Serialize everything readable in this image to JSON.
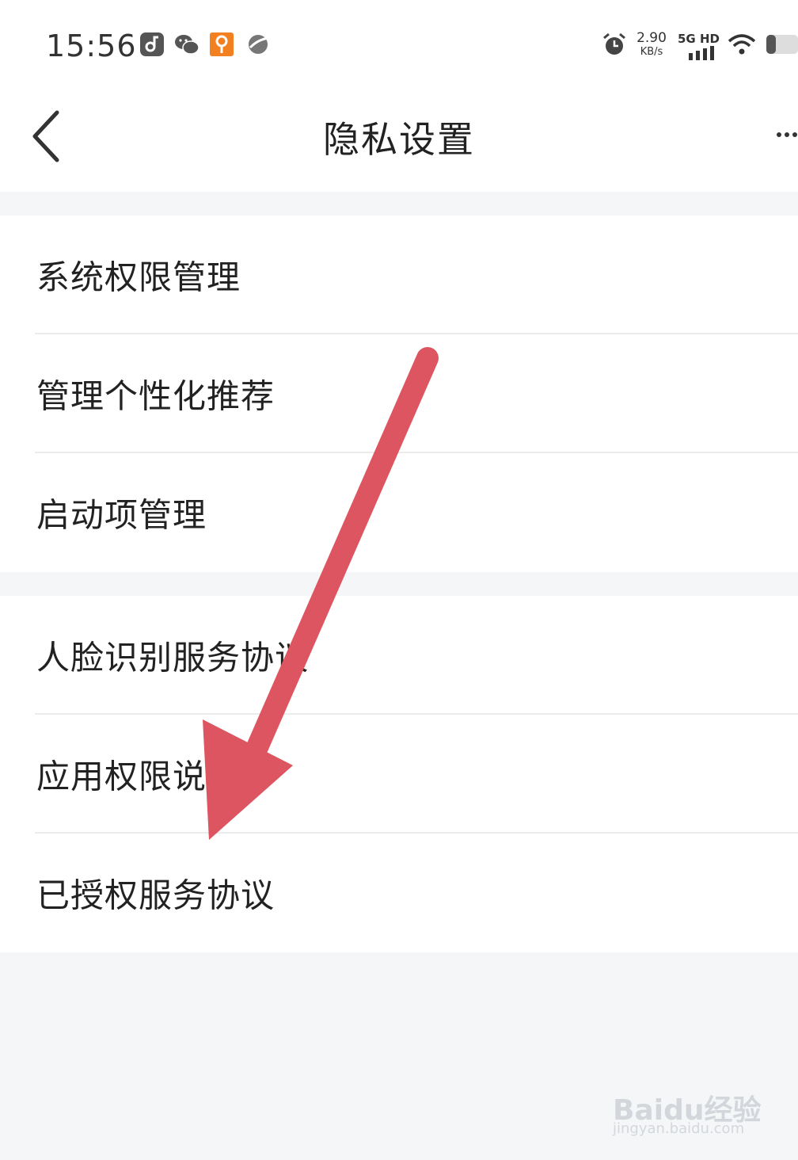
{
  "status_bar": {
    "time": "15:56",
    "net_speed_value": "2.90",
    "net_speed_unit": "KB/s",
    "network_type": "5G HD",
    "icons": [
      "music-icon",
      "wechat-icon",
      "app-icon",
      "browser-icon",
      "alarm-icon",
      "signal-icon",
      "wifi-icon",
      "battery-icon"
    ]
  },
  "nav": {
    "title": "隐私设置",
    "back_icon": "chevron-left-icon",
    "more_icon": "more-icon"
  },
  "groups": [
    {
      "items": [
        {
          "label": "系统权限管理"
        },
        {
          "label": "管理个性化推荐"
        },
        {
          "label": "启动项管理"
        }
      ]
    },
    {
      "items": [
        {
          "label": "人脸识别服务协议"
        },
        {
          "label": "应用权限说明"
        },
        {
          "label": "已授权服务协议"
        }
      ]
    }
  ],
  "annotation": {
    "type": "arrow",
    "color": "#dd5560"
  },
  "watermark": {
    "brand": "Baidu经验",
    "url": "jingyan.baidu.com"
  },
  "colors": {
    "background": "#f5f6f8",
    "surface": "#ffffff",
    "text": "#222222",
    "divider": "#ececec"
  }
}
